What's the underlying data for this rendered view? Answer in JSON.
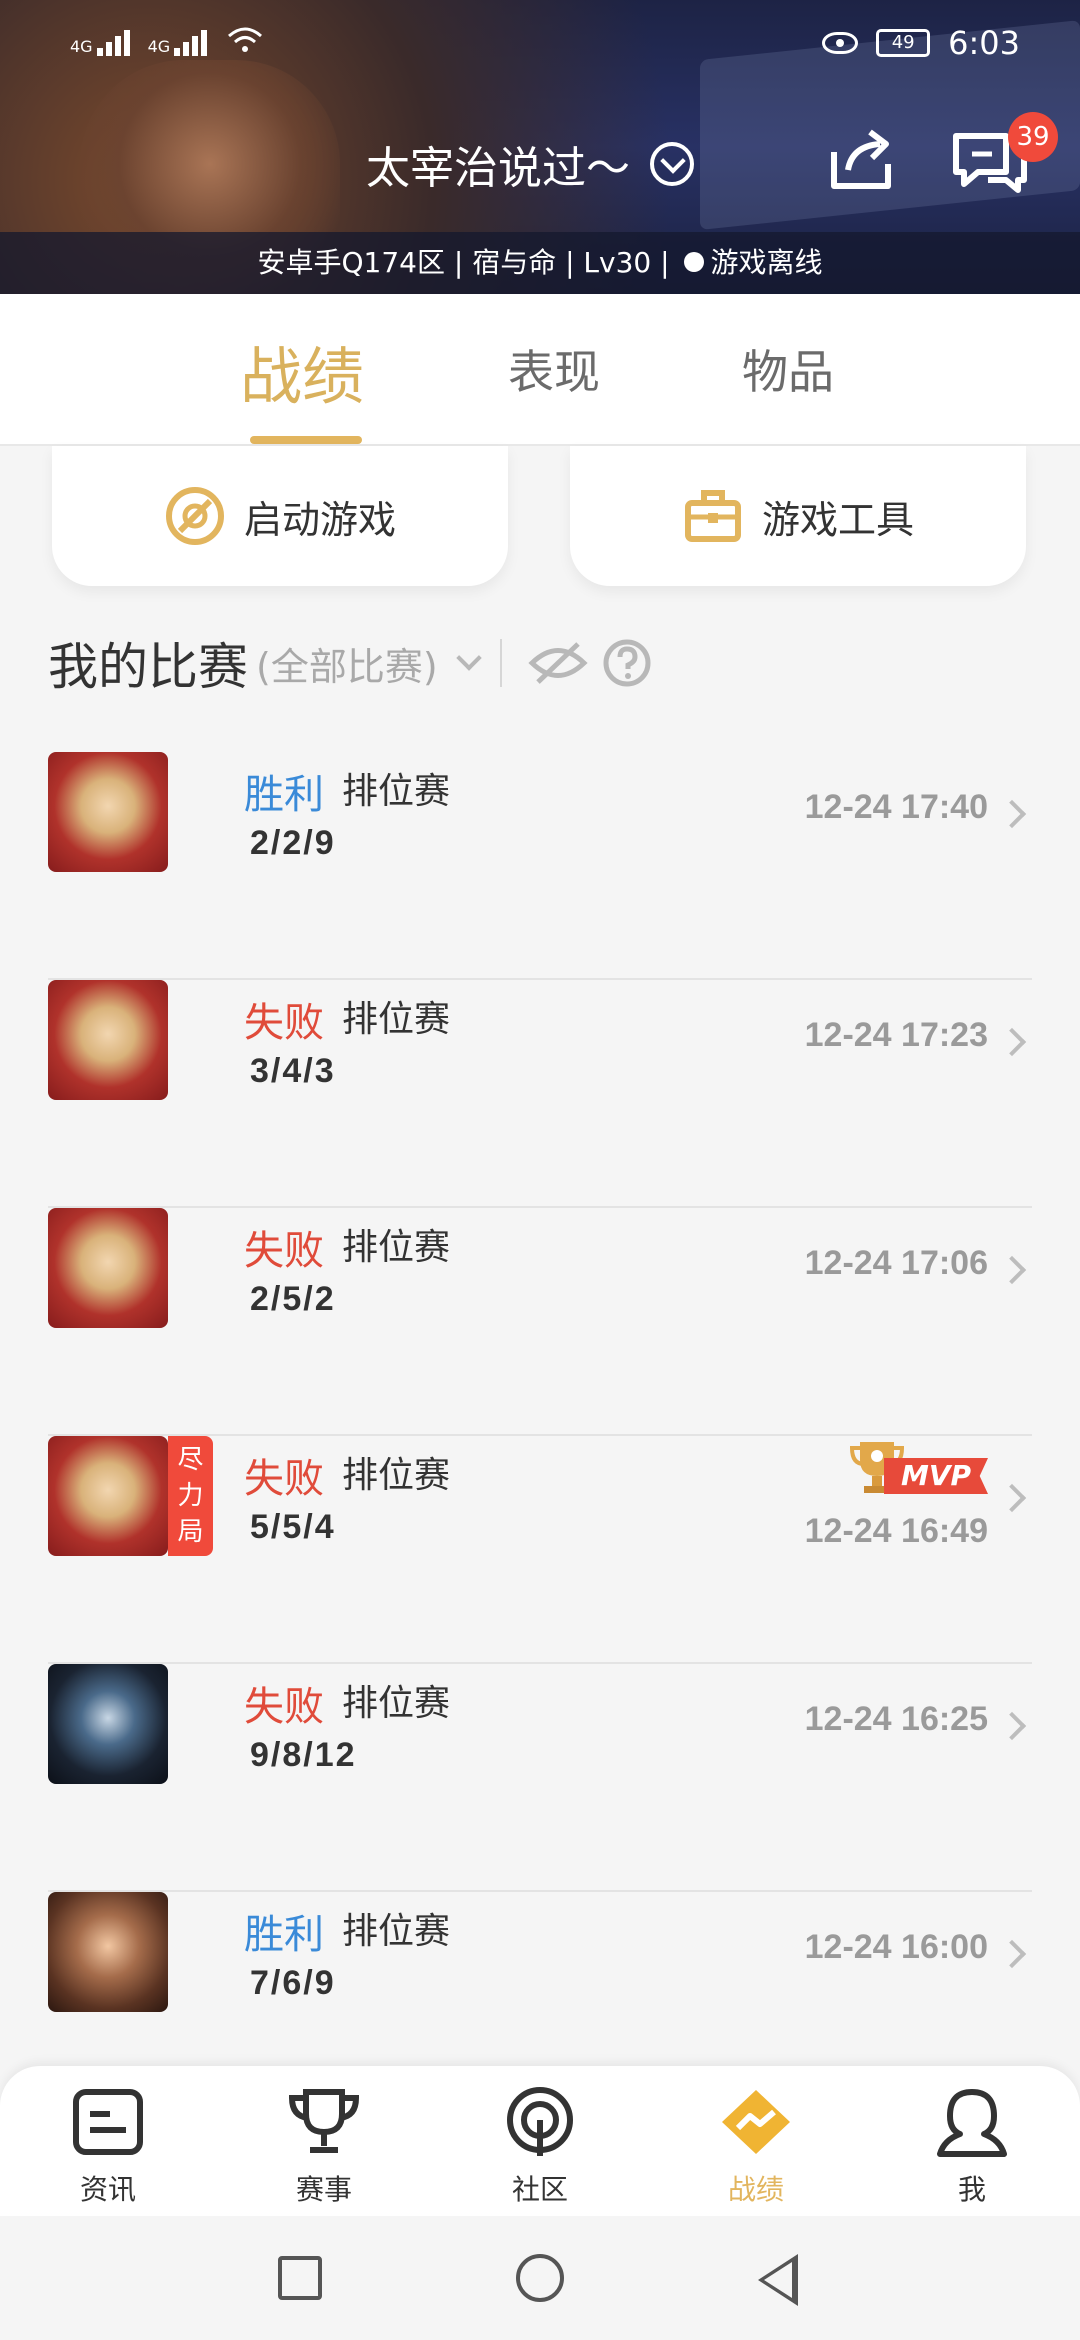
{
  "status_bar": {
    "network_left": "4G",
    "network_right": "4G",
    "battery": "49",
    "time": "6:03"
  },
  "header": {
    "username": "太宰治说过～",
    "info_left": "安卓手Q174区 | 宿与命 | Lv30 |",
    "info_status": "游戏离线",
    "message_badge": "39"
  },
  "tabs": [
    {
      "label": "战绩",
      "active": true
    },
    {
      "label": "表现",
      "active": false
    },
    {
      "label": "物品",
      "active": false
    }
  ],
  "quick_actions": {
    "launch_game": "启动游戏",
    "game_tools": "游戏工具"
  },
  "matches_section": {
    "title": "我的比赛",
    "filter": "(全部比赛)"
  },
  "matches": [
    {
      "result": "胜利",
      "mode": "排位赛",
      "kda": "2/2/9",
      "time": "12-24 17:40",
      "hero": "blonde"
    },
    {
      "result": "失败",
      "mode": "排位赛",
      "kda": "3/4/3",
      "time": "12-24 17:23",
      "hero": "blonde"
    },
    {
      "result": "失败",
      "mode": "排位赛",
      "kda": "2/5/2",
      "time": "12-24 17:06",
      "hero": "blonde"
    },
    {
      "result": "失败",
      "mode": "排位赛",
      "kda": "5/5/4",
      "time": "12-24 16:49",
      "hero": "blonde",
      "badge": "尽力局",
      "mvp": "MVP"
    },
    {
      "result": "失败",
      "mode": "排位赛",
      "kda": "9/8/12",
      "time": "12-24 16:25",
      "hero": "dark"
    },
    {
      "result": "胜利",
      "mode": "排位赛",
      "kda": "7/6/9",
      "time": "12-24 16:00",
      "hero": "brown"
    }
  ],
  "bottom_nav": [
    {
      "label": "资讯",
      "icon": "news-icon"
    },
    {
      "label": "赛事",
      "icon": "trophy-icon"
    },
    {
      "label": "社区",
      "icon": "community-icon"
    },
    {
      "label": "战绩",
      "icon": "record-icon",
      "active": true
    },
    {
      "label": "我",
      "icon": "profile-icon"
    }
  ],
  "colors": {
    "accent": "#e2b55e",
    "win": "#3a8ad8",
    "lose": "#e04b3a",
    "badge": "#f04a3b"
  }
}
